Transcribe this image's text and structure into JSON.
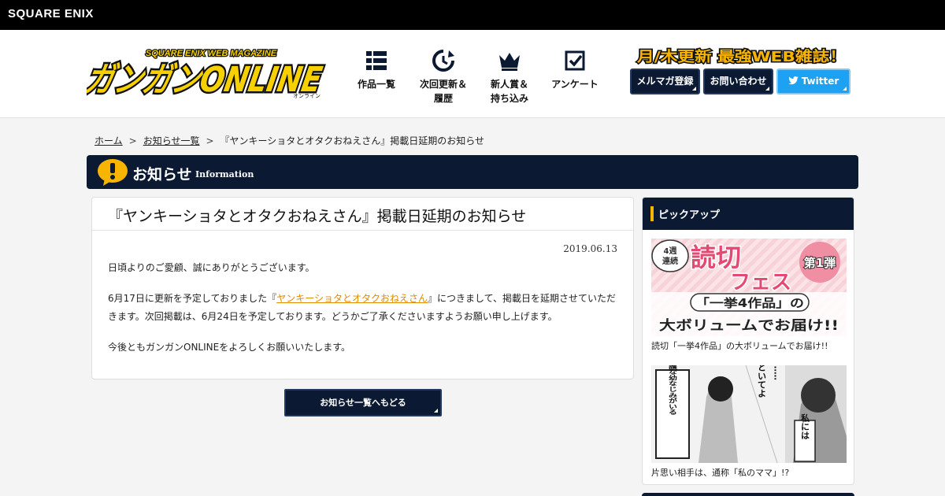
{
  "topbar": {
    "brand": "SQUARE ENIX"
  },
  "header": {
    "logo": {
      "text": "ガンガンONLINE",
      "arc_text": "SQUARE ENIX WEB MAGAZINE",
      "small_text": "オンライン"
    },
    "nav": [
      {
        "label": "作品一覧",
        "icon": "grid-list-icon"
      },
      {
        "label": "次回更新＆\n履歴",
        "icon": "refresh-clock-icon"
      },
      {
        "label": "新人賞＆\n持ち込み",
        "icon": "crown-icon"
      },
      {
        "label": "アンケート",
        "icon": "checkbox-icon"
      }
    ],
    "tagline": "月/木更新 最強WEB雑誌！",
    "buttons": {
      "mailmag": "メルマガ登録",
      "contact": "お問い合わせ",
      "twitter": "Twitter"
    }
  },
  "breadcrumb": {
    "home": "ホーム",
    "list": "お知らせ一覧",
    "current": "『ヤンキーショタとオタクおねえさん』掲載日延期のお知らせ",
    "separator": ">"
  },
  "section": {
    "title": "お知らせ",
    "subtitle": "Information"
  },
  "article": {
    "title": "『ヤンキーショタとオタクおねえさん』掲載日延期のお知らせ",
    "date": "2019.06.13",
    "p1": "日頃よりのご愛顧、誠にありがとうございます。",
    "p2_before": "6月17日に更新を予定しておりました『",
    "p2_link": "ヤンキーショタとオタクおねえさん",
    "p2_after": "』につきまして、掲載日を延期させていただきます。次回掲載は、6月24日を予定しております。どうかご了承くださいますようお願い申し上げます。",
    "p3": "今後ともガンガンONLINEをよろしくお願いいたします。"
  },
  "back_button": "お知らせ一覧へもどる",
  "sidebar": {
    "title": "ピックアップ",
    "items": [
      {
        "caption": "読切「一挙4作品」の大ボリュームでお届け!!",
        "banner": {
          "weeks": "4週",
          "serial": "連続",
          "line1": "読切",
          "line2": "フェス",
          "badge": "第1弾",
          "mid": "「一挙4作品」の",
          "bottom": "大ボリュームでお届け!!"
        }
      },
      {
        "caption": "片思い相手は、通称「私のママ」!?",
        "banner": {
          "box_text": "とても過保護な幼なじみがいる",
          "speech1": "ほっといてよ",
          "speech2": "私には",
          "dots": "……"
        }
      }
    ]
  }
}
